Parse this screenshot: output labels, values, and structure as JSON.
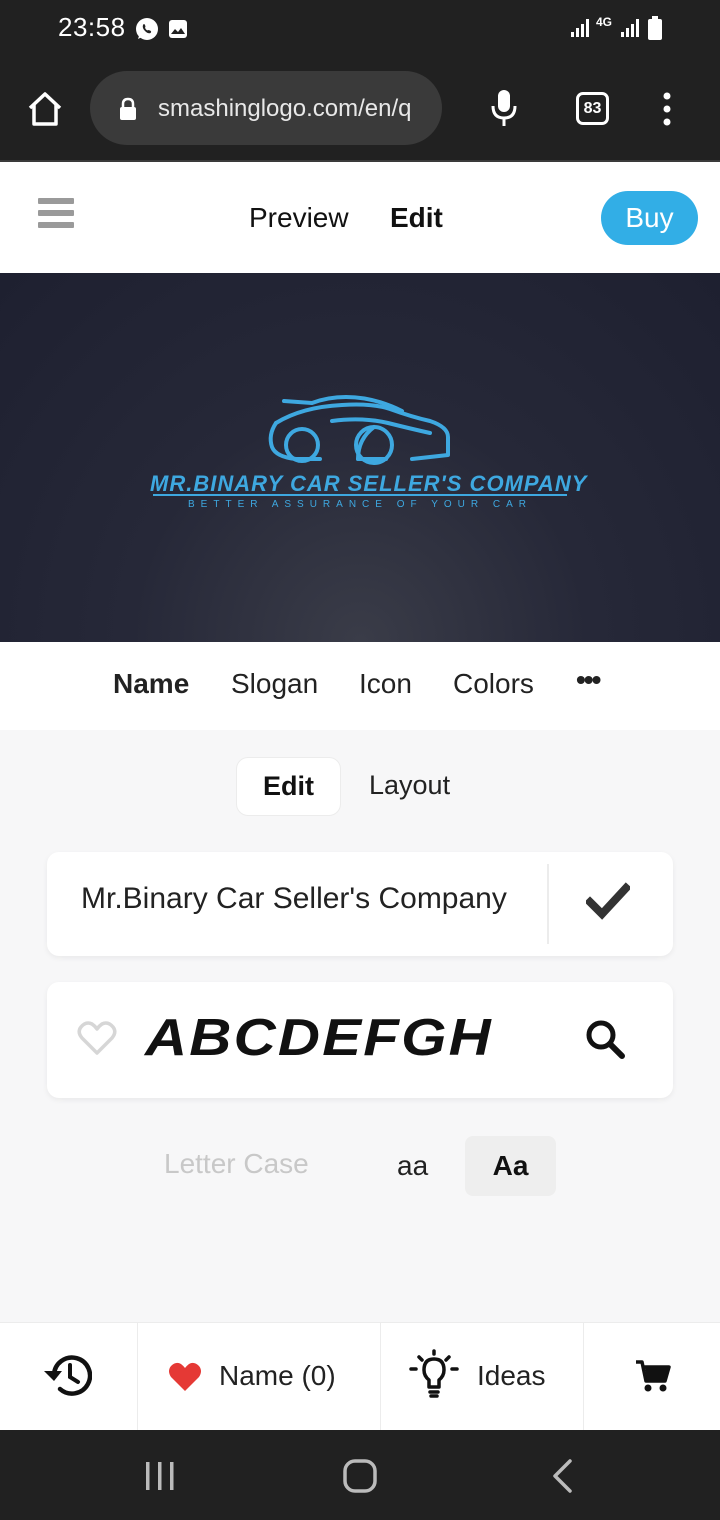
{
  "status_bar": {
    "time": "23:58",
    "network": "4G",
    "icons": [
      "whatsapp-icon",
      "gallery-icon",
      "signal-icon",
      "signal-icon",
      "battery-icon"
    ]
  },
  "browser": {
    "url": "smashinglogo.com/en/q",
    "tab_count": "83",
    "icons": [
      "home-icon",
      "lock-icon",
      "mic-icon",
      "more-vert-icon"
    ]
  },
  "header": {
    "preview_label": "Preview",
    "edit_label": "Edit",
    "buy_label": "Buy"
  },
  "logo_preview": {
    "name": "MR.BINARY CAR SELLER'S COMPANY",
    "slogan": "BETTER ASSURANCE OF YOUR CAR",
    "accent_color": "#3ea8e0",
    "background_color": "#262838"
  },
  "section_tabs": [
    {
      "label": "Name",
      "active": true
    },
    {
      "label": "Slogan",
      "active": false
    },
    {
      "label": "Icon",
      "active": false
    },
    {
      "label": "Colors",
      "active": false
    },
    {
      "label": "•••",
      "active": false
    }
  ],
  "sub_tabs": {
    "edit_label": "Edit",
    "layout_label": "Layout"
  },
  "name_editor": {
    "value": "Mr.Binary Car Seller's Company"
  },
  "font_picker": {
    "sample": "ABCDEFGH"
  },
  "letter_case": {
    "label": "Letter Case",
    "options": [
      "aa",
      "Aa"
    ],
    "selected": "Aa"
  },
  "bottom_bar": {
    "favorites_label": "Name (0)",
    "ideas_label": "Ideas",
    "heart_color": "#e53935"
  },
  "colors": {
    "accent": "#32aee6",
    "chrome": "#212121"
  }
}
